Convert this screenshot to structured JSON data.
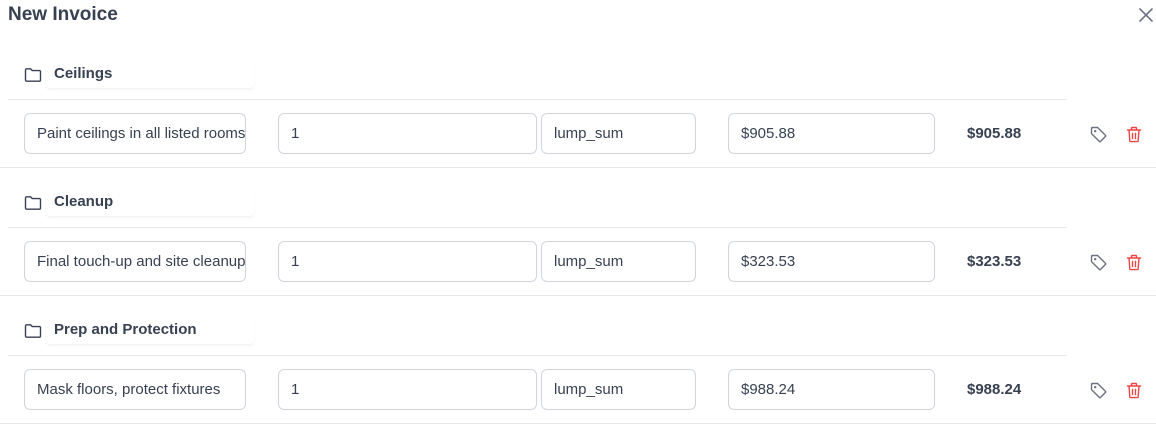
{
  "title": "New Invoice",
  "colors": {
    "delete": "#ef4444",
    "icon": "#6b7280",
    "border": "#d1d5db"
  },
  "icons": {
    "close": "close-icon",
    "folder": "folder-icon",
    "tag": "tag-icon",
    "delete": "trash-icon"
  },
  "groups": [
    {
      "name": "Ceilings",
      "item": {
        "description": "Paint ceilings in all listed rooms",
        "quantity": "1",
        "unit": "lump_sum",
        "unit_price": "$905.88",
        "total": "$905.88"
      }
    },
    {
      "name": "Cleanup",
      "item": {
        "description": "Final touch-up and site cleanup",
        "quantity": "1",
        "unit": "lump_sum",
        "unit_price": "$323.53",
        "total": "$323.53"
      }
    },
    {
      "name": "Prep and Protection",
      "item": {
        "description": "Mask floors, protect fixtures",
        "quantity": "1",
        "unit": "lump_sum",
        "unit_price": "$988.24",
        "total": "$988.24"
      }
    }
  ]
}
